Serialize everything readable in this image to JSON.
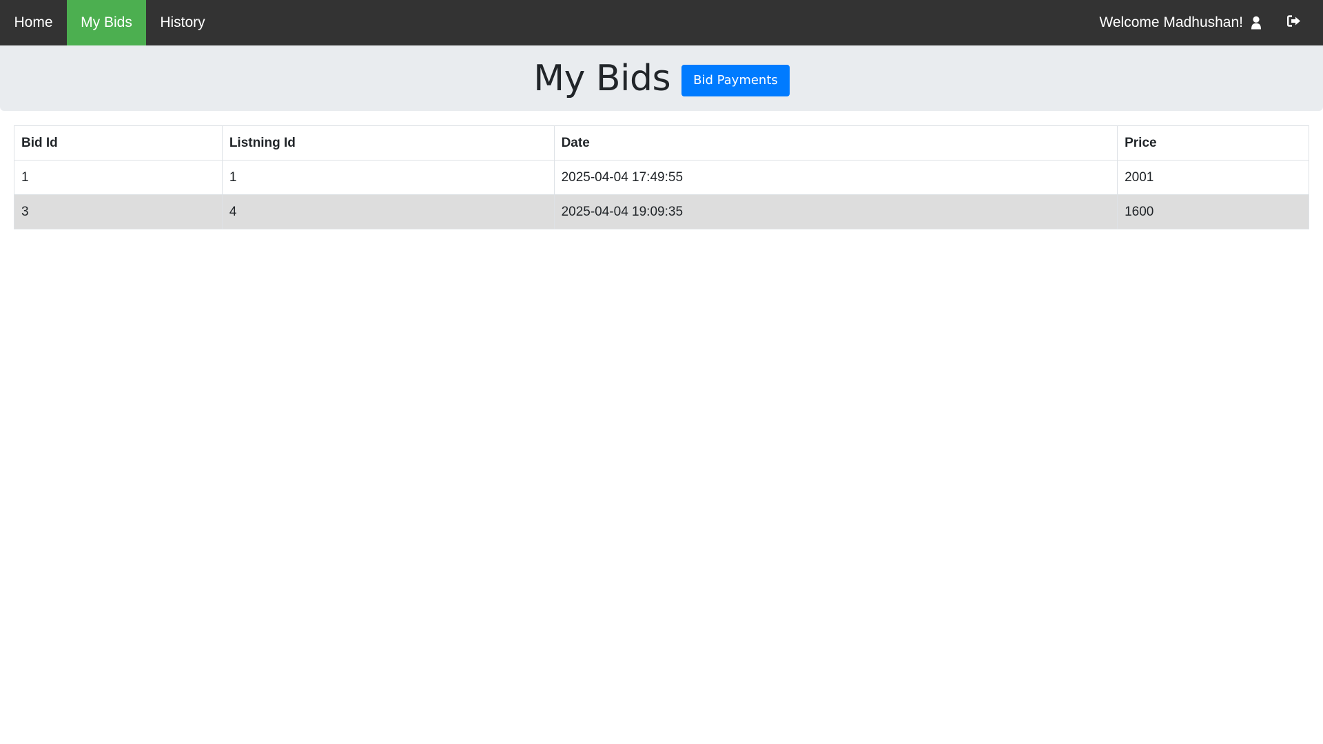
{
  "nav": {
    "home": "Home",
    "my_bids": "My Bids",
    "history": "History",
    "welcome": "Welcome Madhushan!",
    "user_icon": "user-icon",
    "logout_icon": "sign-out-icon",
    "active_color": "#4caf50",
    "bar_color": "#333333"
  },
  "header": {
    "title": "My Bids",
    "button_label": "Bid Payments",
    "button_color": "#007bff"
  },
  "table": {
    "columns": [
      "Bid Id",
      "Listning Id",
      "Date",
      "Price"
    ],
    "rows": [
      [
        "1",
        "1",
        "2025-04-04 17:49:55",
        "2001"
      ],
      [
        "3",
        "4",
        "2025-04-04 19:09:35",
        "1600"
      ]
    ]
  }
}
